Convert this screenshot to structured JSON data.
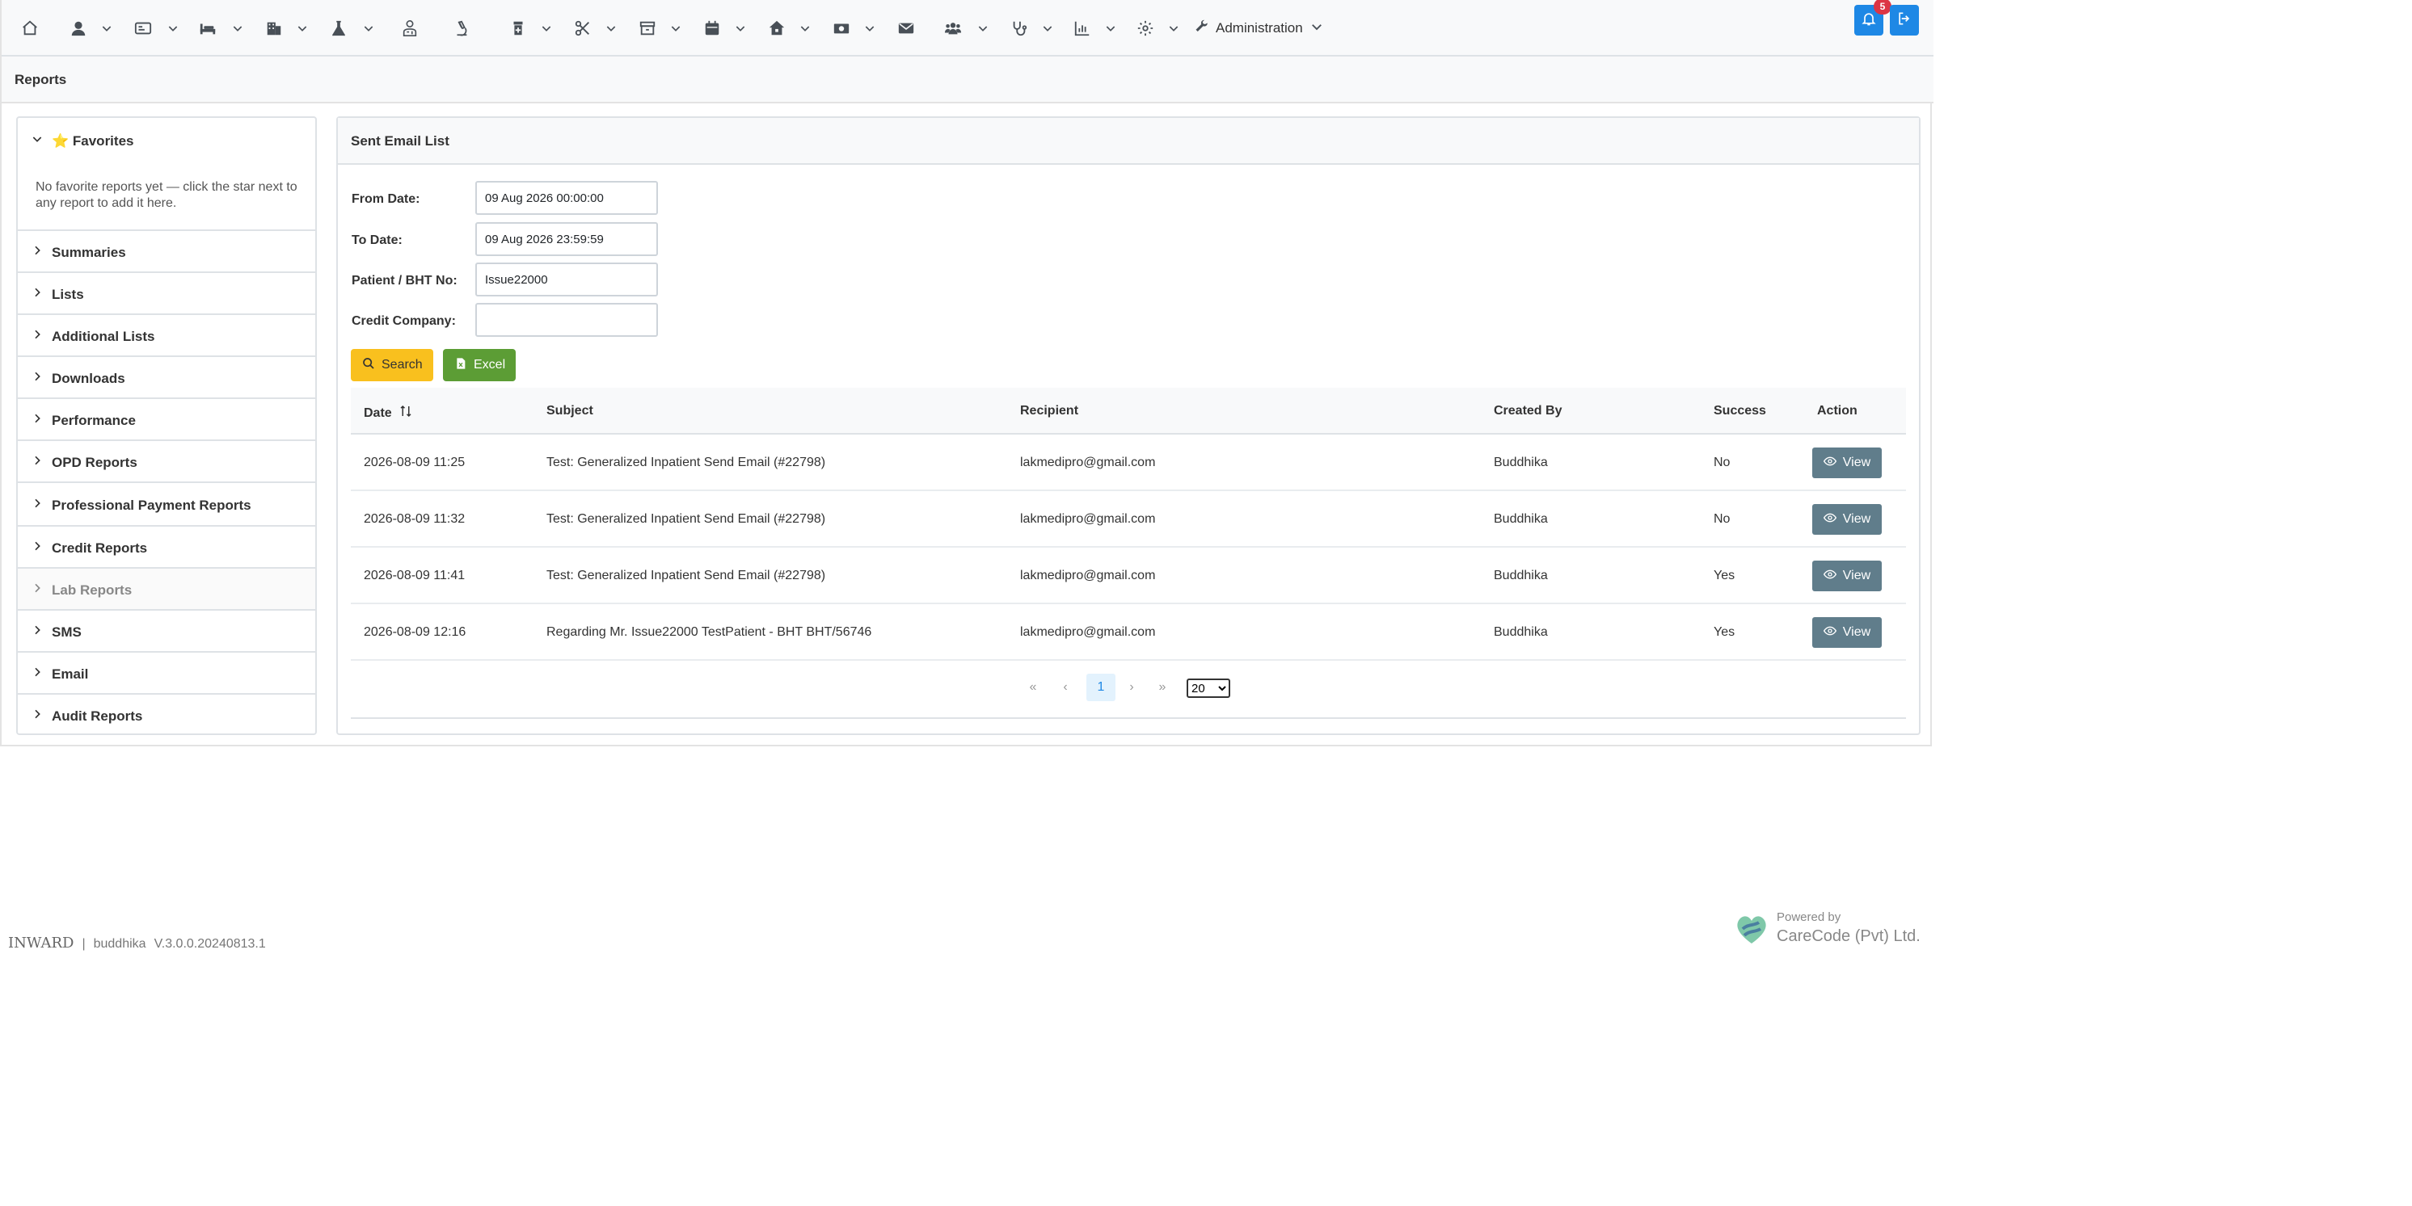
{
  "nav": {
    "icons": [
      "home-icon",
      "user-icon",
      "id-card-icon",
      "bed-icon",
      "building-icon",
      "flask-icon",
      "doctor-icon",
      "microscope-icon",
      "pharmacy-icon",
      "scissors-icon",
      "store-icon",
      "calendar-icon",
      "house-icon",
      "money-icon",
      "envelope-icon",
      "users-icon",
      "stethoscope-icon",
      "chart-icon",
      "gear-icon"
    ],
    "admin_label": "Administration",
    "notification_count": "5"
  },
  "page": {
    "title": "Reports"
  },
  "sidebar": {
    "favorites": {
      "label": "⭐ Favorites",
      "empty_text": "No favorite reports yet — click the star next to any report to add it here."
    },
    "items": [
      {
        "label": "Summaries"
      },
      {
        "label": "Lists"
      },
      {
        "label": "Additional Lists"
      },
      {
        "label": "Downloads"
      },
      {
        "label": "Performance"
      },
      {
        "label": "OPD Reports"
      },
      {
        "label": "Professional Payment Reports"
      },
      {
        "label": "Credit Reports"
      },
      {
        "label": "Lab Reports"
      },
      {
        "label": "SMS"
      },
      {
        "label": "Email"
      },
      {
        "label": "Audit Reports"
      }
    ]
  },
  "main": {
    "title": "Sent Email List",
    "form": {
      "from_date_label": "From Date:",
      "from_date_value": "09 Aug 2026 00:00:00",
      "to_date_label": "To Date:",
      "to_date_value": "09 Aug 2026 23:59:59",
      "patient_label": "Patient / BHT No:",
      "patient_value": "Issue22000",
      "credit_label": "Credit Company:",
      "credit_value": ""
    },
    "buttons": {
      "search": "Search",
      "excel": "Excel"
    },
    "table": {
      "columns": [
        "Date",
        "Subject",
        "Recipient",
        "Created By",
        "Success",
        "Action"
      ],
      "rows": [
        {
          "date": "2026-08-09 11:25",
          "subject": "Test: Generalized Inpatient Send Email (#22798)",
          "recipient": "lakmedipro@gmail.com",
          "created_by": "Buddhika",
          "success": "No",
          "action": "View"
        },
        {
          "date": "2026-08-09 11:32",
          "subject": "Test: Generalized Inpatient Send Email (#22798)",
          "recipient": "lakmedipro@gmail.com",
          "created_by": "Buddhika",
          "success": "No",
          "action": "View"
        },
        {
          "date": "2026-08-09 11:41",
          "subject": "Test: Generalized Inpatient Send Email (#22798)",
          "recipient": "lakmedipro@gmail.com",
          "created_by": "Buddhika",
          "success": "Yes",
          "action": "View"
        },
        {
          "date": "2026-08-09 12:16",
          "subject": "Regarding Mr. Issue22000 TestPatient - BHT BHT/56746",
          "recipient": "lakmedipro@gmail.com",
          "created_by": "Buddhika",
          "success": "Yes",
          "action": "View"
        }
      ]
    },
    "pagination": {
      "first": "«",
      "prev": "‹",
      "current": "1",
      "next": "›",
      "last": "»",
      "rows_per_page": "20"
    }
  },
  "footer": {
    "app": "INWARD",
    "separator": "|",
    "user": "buddhika",
    "version": "V.3.0.0.20240813.1",
    "powered_by": "Powered by",
    "company": "CareCode (Pvt) Ltd."
  },
  "colors": {
    "primary": "#1e88e5",
    "search": "#f9c01e",
    "excel": "#5c9d35",
    "view": "#607d8b",
    "badge": "#dc3545"
  }
}
